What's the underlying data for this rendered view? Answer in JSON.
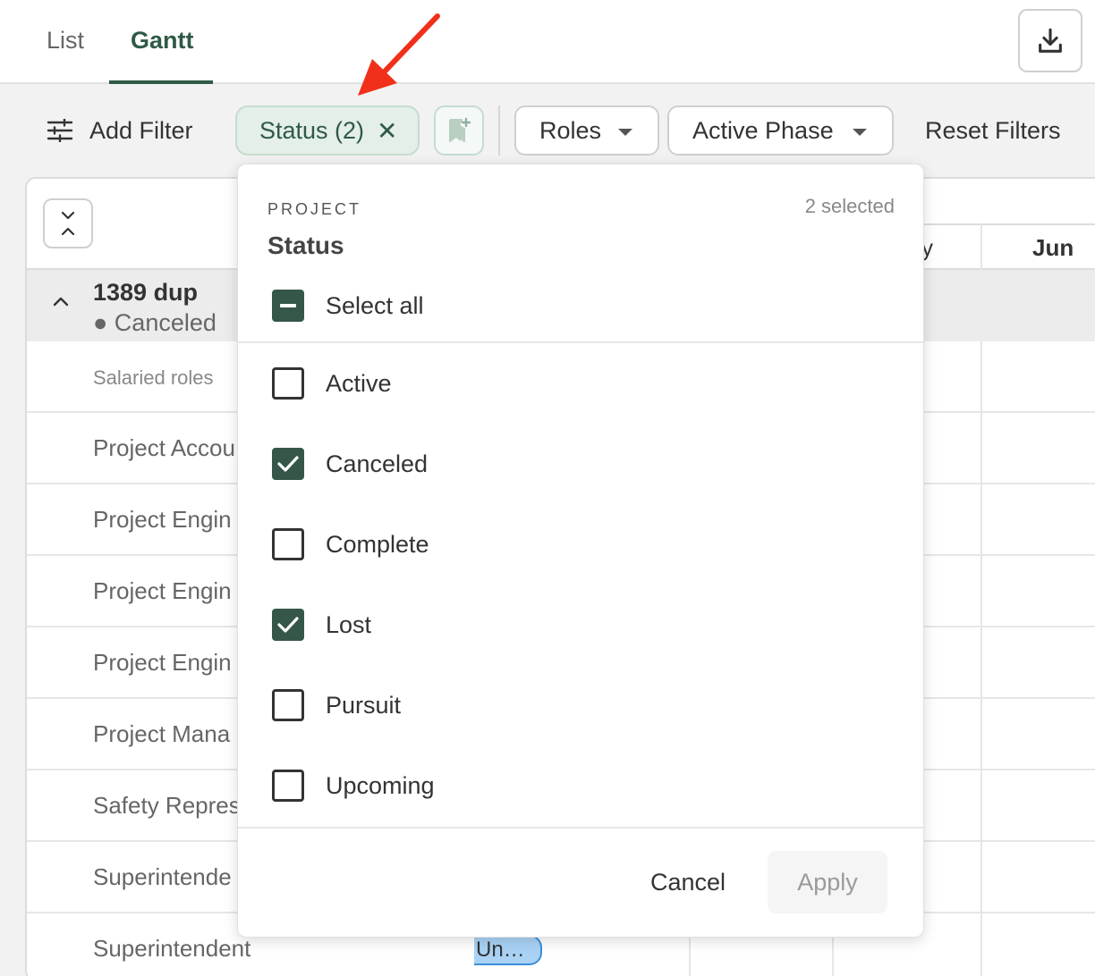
{
  "tabs": [
    {
      "label": "List",
      "active": false
    },
    {
      "label": "Gantt",
      "active": true
    }
  ],
  "toolbar": {
    "download_icon": "download-icon"
  },
  "filters": {
    "add_filter_label": "Add Filter",
    "status_chip_label": "Status (2)",
    "status_chip_close": "✕",
    "roles_label": "Roles",
    "phase_label": "Active Phase",
    "reset_label": "Reset Filters"
  },
  "gantt": {
    "months": [
      "y",
      "Jun"
    ],
    "project": {
      "name": "1389 dup",
      "status": "● Canceled"
    },
    "rows": [
      "Salaried roles",
      "Project Accou",
      "Project Engin",
      "Project Engin",
      "Project Engin",
      "Project Mana",
      "Safety Repres",
      "Superintende",
      "Superintendent"
    ],
    "bar_label": "Un…"
  },
  "dropdown": {
    "overline": "PROJECT",
    "title": "Status",
    "selected_count": "2 selected",
    "select_all_label": "Select all",
    "options": [
      {
        "label": "Active",
        "checked": false
      },
      {
        "label": "Canceled",
        "checked": true
      },
      {
        "label": "Complete",
        "checked": false
      },
      {
        "label": "Lost",
        "checked": true
      },
      {
        "label": "Pursuit",
        "checked": false
      },
      {
        "label": "Upcoming",
        "checked": false
      }
    ],
    "cancel_label": "Cancel",
    "apply_label": "Apply"
  },
  "colors": {
    "accent": "#2f5a45",
    "checkbox_checked": "#35574a",
    "chip_bg": "#e3efe8",
    "bar_fill": "#a9d2f5",
    "bar_border": "#3b8fd9",
    "annotation_arrow": "#f0301a"
  }
}
